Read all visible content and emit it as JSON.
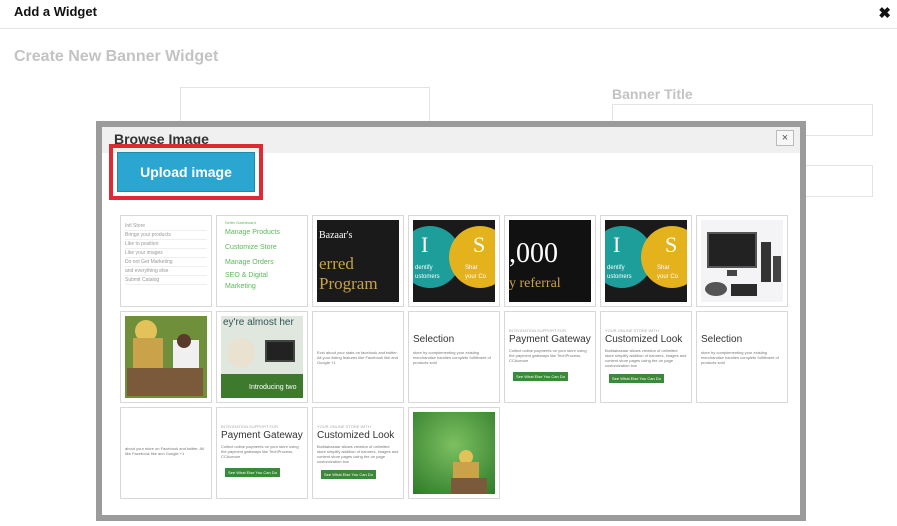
{
  "modal": {
    "title": "Add a Widget",
    "close_glyph": "✖"
  },
  "form": {
    "heading": "Create New Banner Widget",
    "banner_title_label": "Banner Title"
  },
  "browse": {
    "title": "Browse Image",
    "close_glyph": "×",
    "upload_label": "Upload image"
  },
  "tiles": {
    "t1": {
      "lines": [
        "Intl Store",
        "Brings your products",
        "Like to position",
        "Like your images",
        "Do not Get Marketing",
        "and everything else",
        "Submit Catalog"
      ]
    },
    "t2": {
      "header": "Seller Dashboard",
      "items": [
        "Manage Products",
        "Customize Store",
        "Manage Orders",
        "SEO & Digital Marketing"
      ]
    },
    "t3": {
      "l1": "Bazaar's",
      "l2": "erred",
      "l3": "Program"
    },
    "t4": {
      "left_letter": "I",
      "right_letter": "S",
      "left_sub": "dentify\nustomers",
      "right_sub": "Shar\nyour Co"
    },
    "t5": {
      "big": ",000",
      "small": "y referral"
    },
    "t6": {
      "left_letter": "I",
      "right_letter": "S",
      "left_sub": "dentify\nustomers",
      "right_sub": "Shar\nyour Co"
    },
    "t9": {
      "top": "ey're almost her",
      "bottom": "Introducing two"
    },
    "t10": {
      "text": "Ecst about your stats on facebook and twitter. All your listing features like Facebook like and Google +1"
    },
    "t11": {
      "title": "Selection",
      "text": "store by complementing your existing merchandise handles complete fulfillment of products sold"
    },
    "t12": {
      "kicker": "INTEGRATION SUPPORT FOR",
      "title": "Payment Gateway",
      "text": "Collect online payments on your store using the payment gateways like TechProcess, CCAvenue",
      "btn": "See What Else You Can Do"
    },
    "t13": {
      "kicker": "YOUR ONLINE STORE WITH",
      "title": "Customized Look",
      "text": "Buildabazaar allows creation of unlimited store simplify addition of banners, images and content store pages using the on page customization tool",
      "btn": "See What Else You Can Do"
    },
    "t14": {
      "title": "Selection",
      "text": "store by complementing your existing merchandise handles complete fulfillment of products sold"
    },
    "t15": {
      "text": "about your store on Facebook and twitter. All like Facebook like and Google +1"
    },
    "t16": {
      "kicker": "INTEGRATION SUPPORT FOR",
      "title": "Payment Gateway",
      "text": "Collect online payments on your store using the payment gateways like TechProcess, CCAvenue",
      "btn": "See What Else You Can Do"
    },
    "t17": {
      "kicker": "YOUR ONLINE STORE WITH",
      "title": "Customized Look",
      "text": "Buildabazaar allows creation of unlimited store simplify addition of banners, images and content store pages using the on page customization tool",
      "btn": "See What Else You Can Do"
    }
  },
  "colors": {
    "accent": "#2ba6d0",
    "highlight": "#e02a33",
    "gold": "#e4b21c",
    "teal": "#1d9e9a"
  }
}
